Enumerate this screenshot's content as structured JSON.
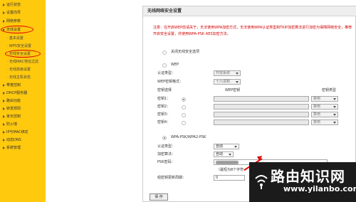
{
  "sidebar": {
    "items": [
      {
        "label": "运行状态"
      },
      {
        "label": "设置向导"
      },
      {
        "label": "网络参数"
      },
      {
        "label": "无线设置"
      },
      {
        "label": "基本设置"
      },
      {
        "label": "WPS安全设置"
      },
      {
        "label": "无线安全设置"
      },
      {
        "label": "无线MAC地址过滤"
      },
      {
        "label": "无线高级设置"
      },
      {
        "label": "无线主机状态"
      },
      {
        "label": "带宽控制"
      },
      {
        "label": "DHCP服务器"
      },
      {
        "label": "路由功能"
      },
      {
        "label": "转发规则"
      },
      {
        "label": "家长控制"
      },
      {
        "label": "防火墙"
      },
      {
        "label": "IP与MAC绑定"
      },
      {
        "label": "动态DNS"
      },
      {
        "label": "系统管理"
      }
    ]
  },
  "panel": {
    "title": "无线网络安全设置",
    "notice": "注意：在开启WEP前请关于，无法使用WPA加密方式，无法使用WPA认证类型和TKIP加密算法进行加密为保障网络安全，推荐开启安全设置，并使用WPA-PSK AES加密方法。",
    "option_none": "关闭无线安全选项",
    "wep": {
      "heading": "WEP",
      "auth_label": "认证类型：",
      "auth_value": "开放系统",
      "format_label": "WEP密钥格式：",
      "format_value": "十六进制",
      "key_select_header": "密钥选择",
      "key_header": "WEP密钥",
      "key_type_header": "密钥类型",
      "keys": [
        {
          "label": "密钥1：",
          "type": "禁用"
        },
        {
          "label": "密钥2：",
          "type": "禁用"
        },
        {
          "label": "密钥3：",
          "type": "禁用"
        },
        {
          "label": "密钥4：",
          "type": "禁用"
        }
      ]
    },
    "wpa": {
      "heading": "WPA-PSK/WPA2-PSK",
      "auth_label": "认证类型：",
      "auth_value": "自动",
      "enc_label": "加密算法：",
      "enc_value": "自动",
      "psk_label": "PSK密码：",
      "psk_hint": "（最短为8个字符",
      "renew_label": "组密钥更新周期：",
      "renew_value": "0"
    },
    "save_label": "保 存"
  },
  "watermark": {
    "title": "路由知识网",
    "url": "www.yilanbo.com"
  },
  "colors": {
    "sidebar_bg": "#ffc90e",
    "notice_red": "#d40000",
    "highlight_red": "#e00000"
  }
}
